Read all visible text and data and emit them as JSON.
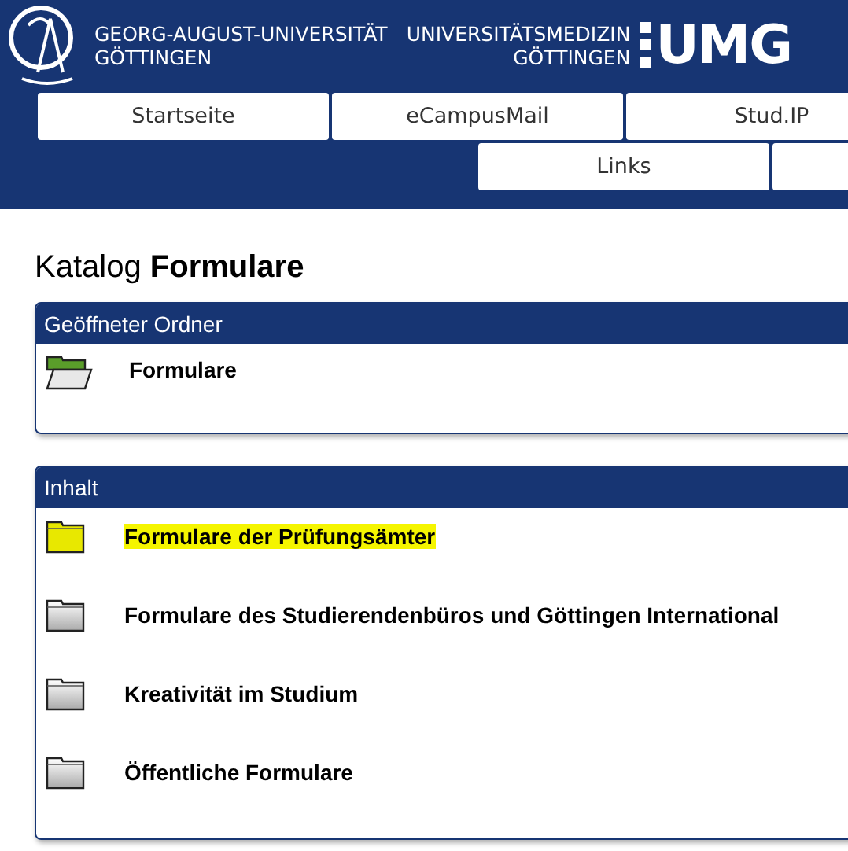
{
  "header": {
    "university": [
      "GEORG-AUGUST-UNIVERSITÄT",
      "GÖTTINGEN"
    ],
    "medicine": [
      "UNIVERSITÄTSMEDIZIN",
      "GÖTTINGEN"
    ],
    "umg": "UMG"
  },
  "nav_rows": [
    [
      "Startseite",
      "eCampusMail",
      "Stud.IP"
    ],
    [
      "Links",
      ""
    ]
  ],
  "title": "Katalog **Formulare**",
  "opened_folder": {
    "heading": "Geöffneter Ordner",
    "name": "Formulare"
  },
  "content": {
    "heading": "Inhalt",
    "items": [
      {
        "name": "Formulare der Prüfungsämter",
        "highlighted": true
      },
      {
        "name": "Formulare des Studierendenbüros und Göttingen International",
        "highlighted": false
      },
      {
        "name": "Kreativität im Studium",
        "highlighted": false
      },
      {
        "name": "Öffentliche Formulare",
        "highlighted": false
      }
    ]
  }
}
